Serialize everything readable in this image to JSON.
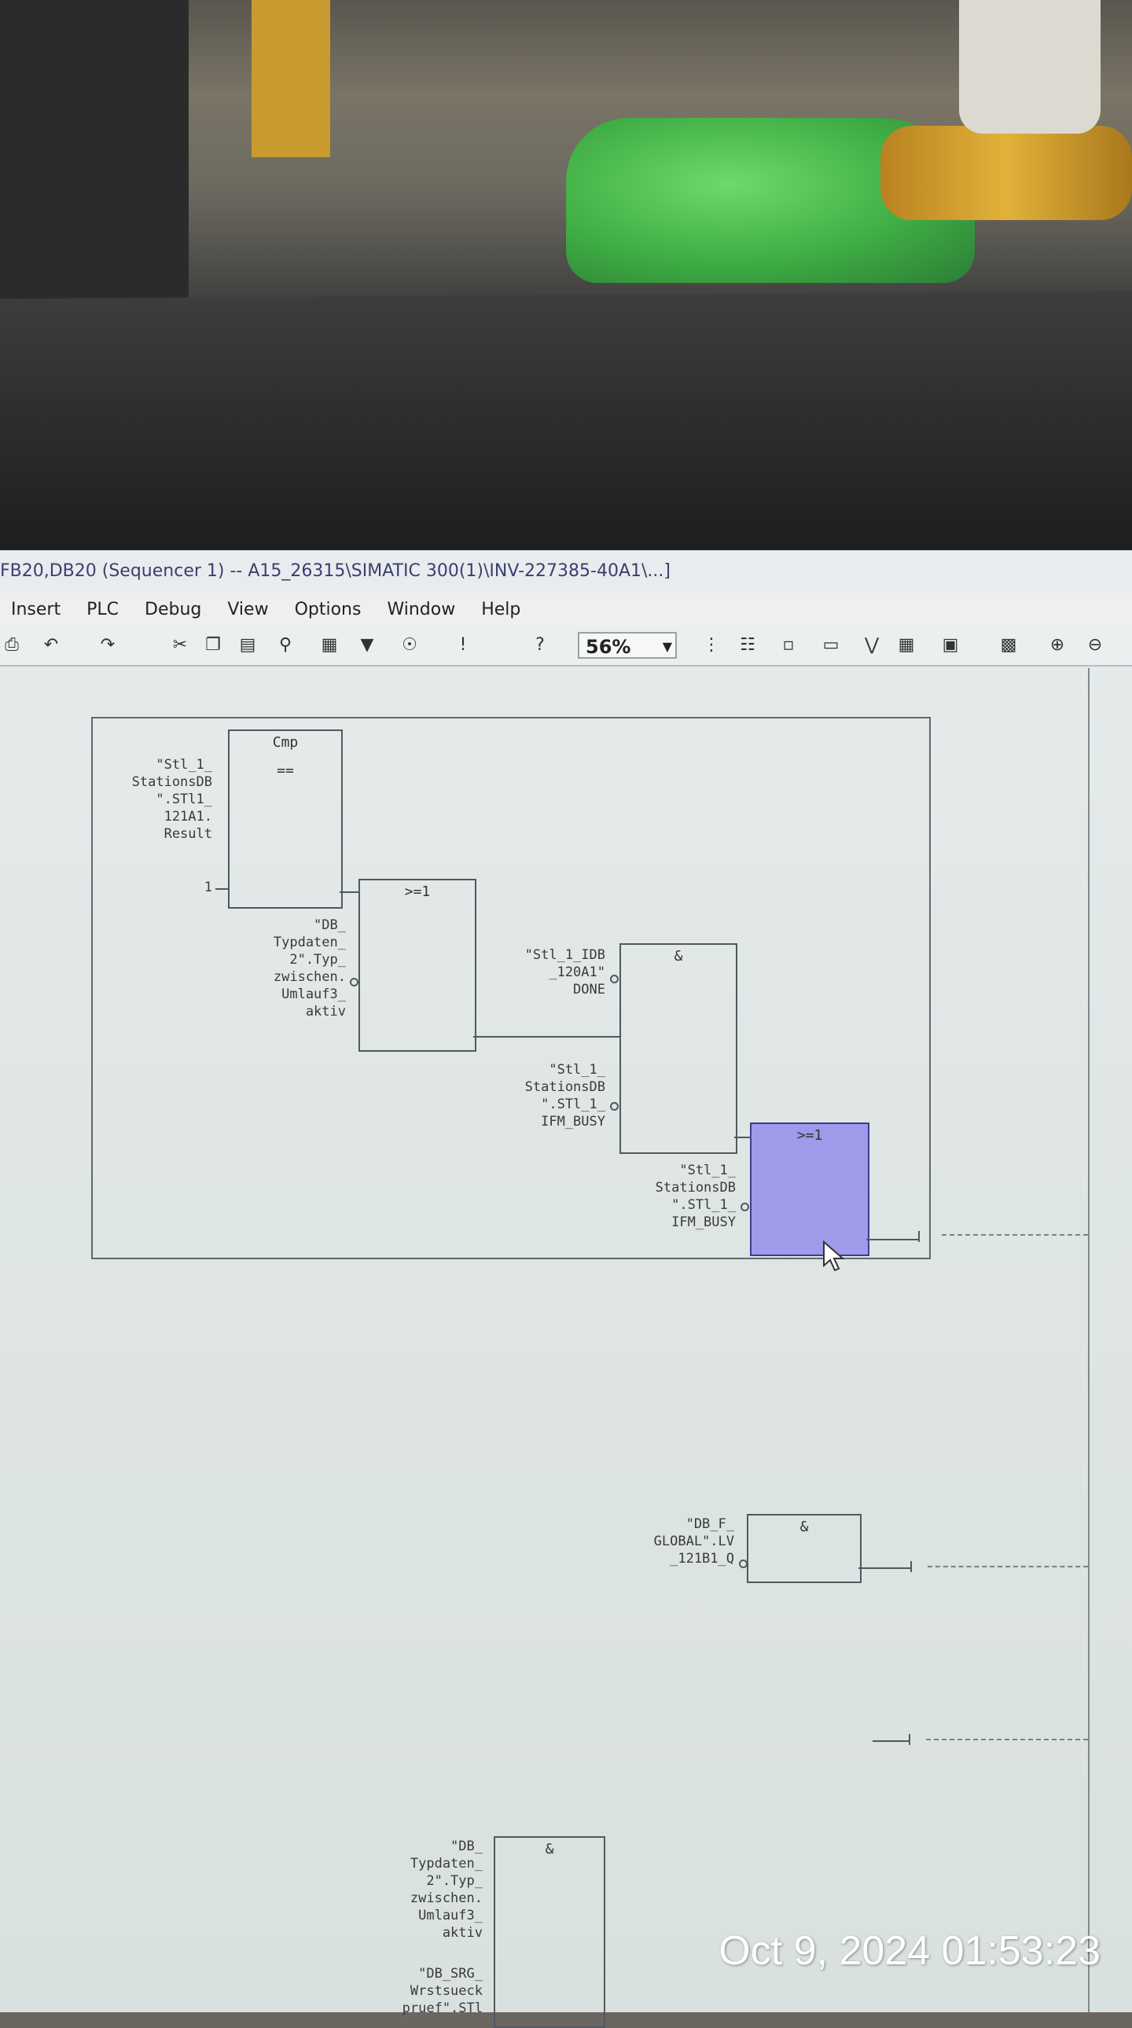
{
  "window": {
    "title": "FB20,DB20 (Sequencer 1) -- A15_26315\\SIMATIC 300(1)\\INV-227385-40A1\\...]"
  },
  "menu": [
    "Insert",
    "PLC",
    "Debug",
    "View",
    "Options",
    "Window",
    "Help"
  ],
  "toolbar": {
    "zoom_value": "56%",
    "icons": [
      "print-icon",
      "undo-icon",
      "redo-icon",
      "cut-icon",
      "copy-icon",
      "paste-icon",
      "find-icon",
      "go-online-icon",
      "download-icon",
      "monitor-icon",
      "breakpoint-icon",
      "help-context-icon",
      "network-icon",
      "ladder-icon",
      "fbd-icon",
      "stl-icon",
      "overview-icon",
      "zoom-in-icon",
      "zoom-out-icon"
    ]
  },
  "diagram": {
    "cmp_block": {
      "title": "Cmp",
      "op": "=="
    },
    "cmp_in1": "\"Stl_1_\nStationsDB\n\".STl1_\n121A1.\nResult",
    "cmp_in2": "1",
    "or_block1": {
      "title": ">=1"
    },
    "or_in2": "\"DB_\nTypdaten_\n2\".Typ_\nzwischen.\nUmlauf3_\naktiv",
    "and_block1": {
      "title": "&"
    },
    "and_in1": "\"Stl_1_IDB\n_120A1\"\nDONE",
    "and_in3": "\"Stl_1_\nStationsDB\n\".STl_1_\nIFM_BUSY",
    "or_block2": {
      "title": ">=1"
    },
    "or2_in2": "\"Stl_1_\nStationsDB\n\".STl_1_\nIFM_BUSY",
    "and_block2": {
      "title": "&"
    },
    "and2_in1": "\"DB_F_\nGLOBAL\".LV\n_121B1_Q",
    "and_block3": {
      "title": "&"
    },
    "and3_in1": "\"DB_\nTypdaten_\n2\".Typ_\nzwischen.\nUmlauf3_\naktiv",
    "and3_in2": "\"DB_SRG_\nWrstsueck\npruef\".STl"
  },
  "timestamp": "Oct 9, 2024 01:53:23"
}
